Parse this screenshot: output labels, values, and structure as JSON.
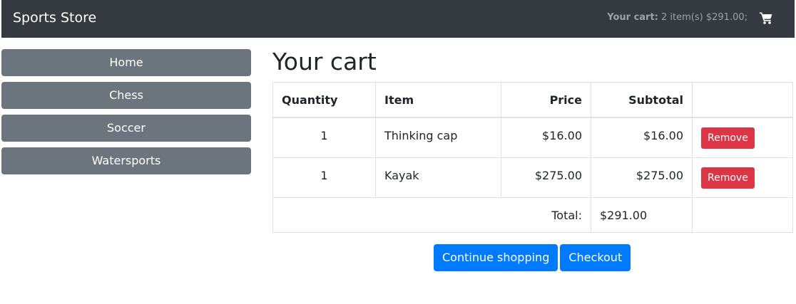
{
  "navbar": {
    "brand": "Sports Store",
    "cart_label": "Your cart:",
    "cart_details": "2 item(s) $291.00;",
    "cart_icon": "shopping-cart-icon"
  },
  "sidebar": {
    "categories": [
      {
        "label": "Home"
      },
      {
        "label": "Chess"
      },
      {
        "label": "Soccer"
      },
      {
        "label": "Watersports"
      }
    ]
  },
  "main": {
    "title": "Your cart",
    "table": {
      "headers": {
        "quantity": "Quantity",
        "item": "Item",
        "price": "Price",
        "subtotal": "Subtotal",
        "actions": ""
      },
      "rows": [
        {
          "quantity": "1",
          "item": "Thinking cap",
          "price": "$16.00",
          "subtotal": "$16.00",
          "action": "Remove"
        },
        {
          "quantity": "1",
          "item": "Kayak",
          "price": "$275.00",
          "subtotal": "$275.00",
          "action": "Remove"
        }
      ],
      "total_label": "Total:",
      "total_value": "$291.00"
    },
    "buttons": {
      "continue": "Continue shopping",
      "checkout": "Checkout"
    }
  },
  "colors": {
    "navbar": "#343a40",
    "secondary": "#6c757d",
    "primary": "#007bff",
    "danger": "#dc3545",
    "border": "#dee2e6"
  }
}
